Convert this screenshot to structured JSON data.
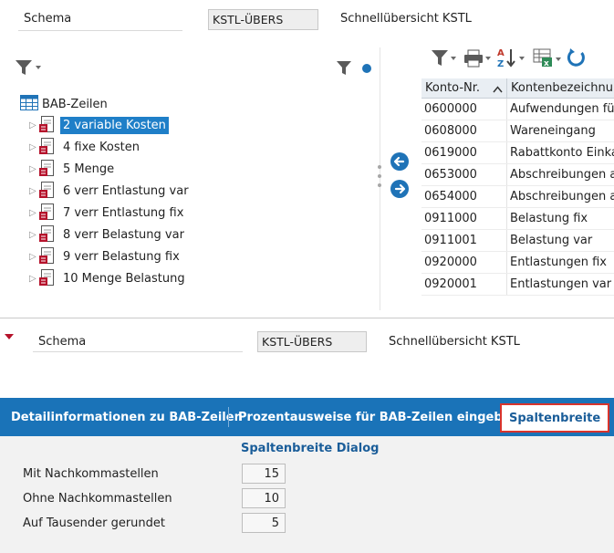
{
  "header": {
    "schema_label": "Schema",
    "schema_value": "KSTL-ÜBERS",
    "schema_desc": "Schnellübersicht KSTL"
  },
  "tree": {
    "root_label": "BAB-Zeilen",
    "items": [
      {
        "label": "2  variable Kosten",
        "selected": true
      },
      {
        "label": "4  fixe Kosten"
      },
      {
        "label": "5  Menge"
      },
      {
        "label": "6  verr Entlastung var"
      },
      {
        "label": "7  verr Entlastung fix"
      },
      {
        "label": "8  verr Belastung var"
      },
      {
        "label": "9  verr  Belastung fix"
      },
      {
        "label": "10  Menge Belastung"
      }
    ]
  },
  "grid": {
    "headers": [
      "Konto-Nr.",
      "Kontenbezeichnung"
    ],
    "rows": [
      [
        "0600000",
        "Aufwendungen für"
      ],
      [
        "0608000",
        "Wareneingang"
      ],
      [
        "0619000",
        "Rabattkonto Einka"
      ],
      [
        "0653000",
        "Abschreibungen au"
      ],
      [
        "0654000",
        "Abschreibungen au"
      ],
      [
        "0911000",
        "Belastung    fix"
      ],
      [
        "0911001",
        "Belastung    var"
      ],
      [
        "0920000",
        "Entlastungen fix"
      ],
      [
        "0920001",
        "Entlastungen var"
      ]
    ]
  },
  "detail": {
    "schema_label": "Schema",
    "schema_value": "KSTL-ÜBERS",
    "schema_desc": "Schnellübersicht KSTL"
  },
  "tabs": [
    {
      "label": "Detailinformationen zu BAB-Zeilen"
    },
    {
      "label": "Prozentausweise für BAB-Zeilen eingeben"
    },
    {
      "label": "Spaltenbreite",
      "active": true
    }
  ],
  "dialog": {
    "title": "Spaltenbreite Dialog",
    "fields": [
      {
        "label": "Mit Nachkommastellen",
        "value": "15"
      },
      {
        "label": "Ohne Nachkommastellen",
        "value": "10"
      },
      {
        "label": "Auf Tausender gerundet",
        "value": "5"
      }
    ]
  },
  "colors": {
    "accent": "#1a73b8",
    "selection": "#1f7fc8",
    "active_tab_border": "#d9342c"
  }
}
